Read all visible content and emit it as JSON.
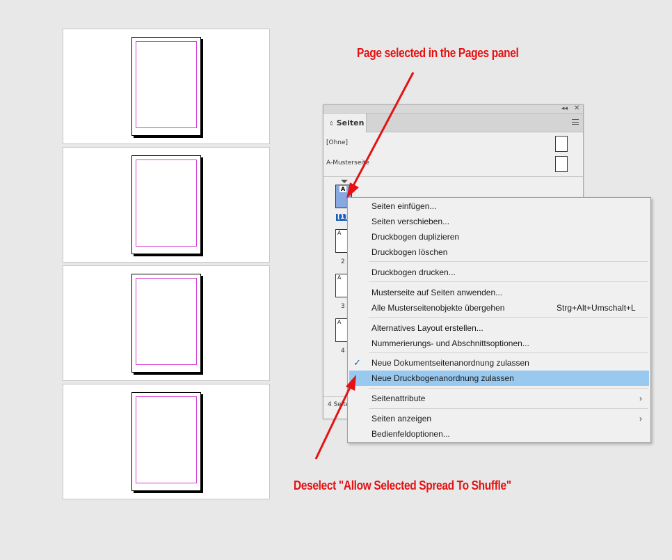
{
  "annotations": {
    "top": "Page selected in the Pages panel",
    "bottom": "Deselect \"Allow Selected Spread To Shuffle\""
  },
  "colors": {
    "annotation": "#e41212",
    "margin_guide": "#d43fd4",
    "menu_highlight": "#99c9ef",
    "selected_page": "#88a8e0",
    "selected_label": "#1c5fb8"
  },
  "panel": {
    "tab_label": "Seiten",
    "masters": [
      {
        "label": "[Ohne]"
      },
      {
        "label": "A-Musterseite"
      }
    ],
    "pages": [
      {
        "letter": "A",
        "number": "[1]",
        "selected": true
      },
      {
        "letter": "A",
        "number": "2",
        "selected": false
      },
      {
        "letter": "A",
        "number": "3",
        "selected": false
      },
      {
        "letter": "A",
        "number": "4",
        "selected": false
      }
    ],
    "footer": "4 Seiten"
  },
  "menu": {
    "items": [
      {
        "label": "Seiten einfügen..."
      },
      {
        "label": "Seiten verschieben..."
      },
      {
        "label": "Druckbogen duplizieren"
      },
      {
        "label": "Druckbogen löschen"
      },
      {
        "label": "Druckbogen drucken..."
      },
      {
        "label": "Musterseite auf Seiten anwenden..."
      },
      {
        "label": "Alle Musterseitenobjekte übergehen",
        "shortcut": "Strg+Alt+Umschalt+L"
      },
      {
        "label": "Alternatives Layout erstellen..."
      },
      {
        "label": "Nummerierungs- und Abschnittsoptionen..."
      },
      {
        "label": "Neue Dokumentseitenanordnung zulassen",
        "checked": true
      },
      {
        "label": "Neue Druckbogenanordnung zulassen",
        "highlighted": true
      },
      {
        "label": "Seitenattribute",
        "submenu": true
      },
      {
        "label": "Seiten anzeigen",
        "submenu": true
      },
      {
        "label": "Bedienfeldoptionen..."
      }
    ]
  }
}
